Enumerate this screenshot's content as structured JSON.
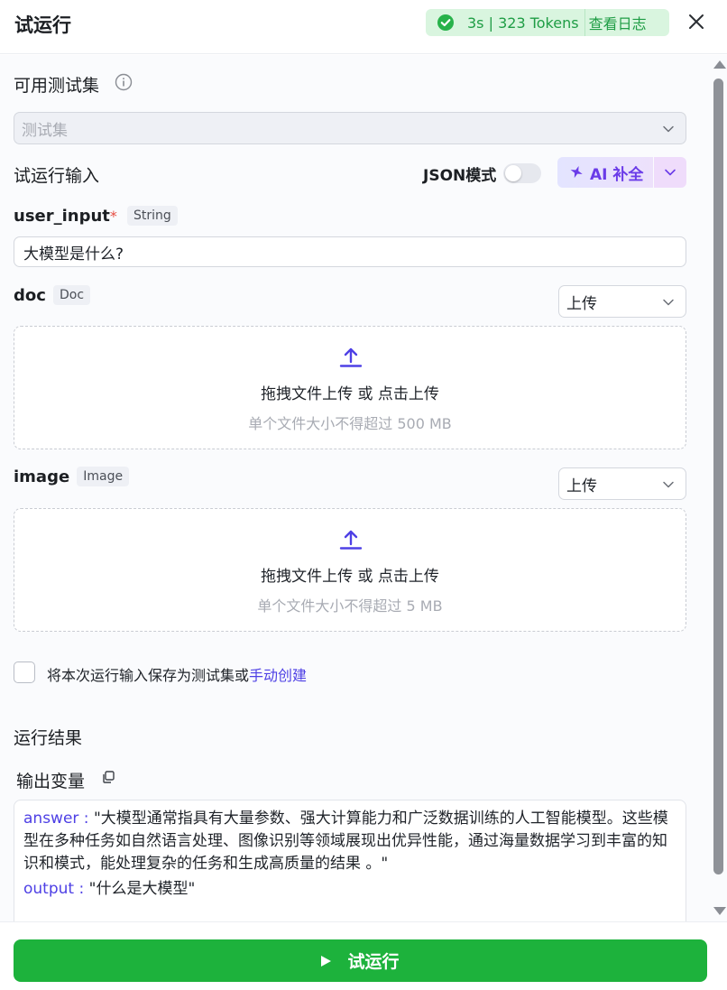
{
  "header": {
    "title": "试运行",
    "status_stats": "3s | 323 Tokens",
    "log_link": "查看日志"
  },
  "test_set": {
    "label": "可用测试集",
    "placeholder": "测试集"
  },
  "run_input": {
    "label": "试运行输入",
    "json_mode_label": "JSON模式",
    "json_mode_on": false,
    "ai_fill_label": "AI 补全"
  },
  "fields": {
    "user_input": {
      "name": "user_input",
      "type": "String",
      "value": "大模型是什么?"
    },
    "doc": {
      "name": "doc",
      "type": "Doc",
      "source": "上传",
      "drop_text": "拖拽文件上传 或 点击上传",
      "hint": "单个文件大小不得超过 500 MB"
    },
    "image": {
      "name": "image",
      "type": "Image",
      "source": "上传",
      "drop_text": "拖拽文件上传 或 点击上传",
      "hint": "单个文件大小不得超过 5 MB"
    }
  },
  "save_option": {
    "text": "将本次运行输入保存为测试集或",
    "link": "手动创建"
  },
  "results": {
    "title": "运行结果",
    "output_label": "输出变量",
    "answer_key": "answer",
    "answer_value": "\"大模型通常指具有大量参数、强大计算能力和广泛数据训练的人工智能模型。这些模型在多种任务如自然语言处理、图像识别等领域展现出优异性能，通过海量数据学习到丰富的知识和模式，能处理复杂的任务和生成高质量的结果 。\"",
    "output_key": "output",
    "output_value": "\"什么是大模型\""
  },
  "footer": {
    "run_label": "试运行"
  },
  "colors": {
    "accent": "#4e40e5",
    "success": "#1db23c",
    "required": "#e54d42"
  }
}
